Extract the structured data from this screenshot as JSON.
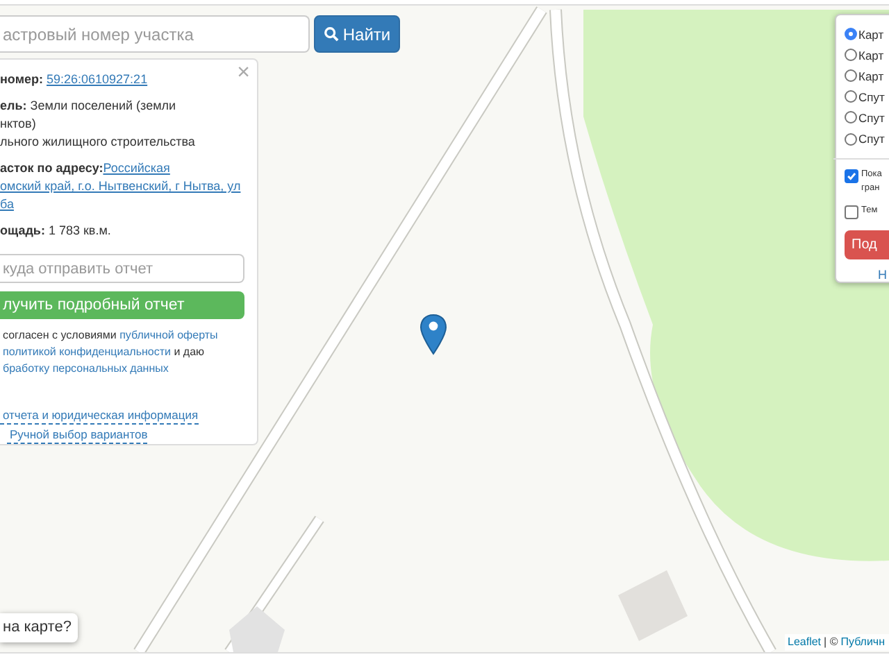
{
  "search": {
    "placeholder": "астровый номер участка",
    "button": "Найти"
  },
  "info": {
    "close": "×",
    "number_label": "номер:",
    "number_link": "59:26:0610927:21",
    "purpose": "**ель:** Земли поселений (земли\nнктов)\nльного жилищного строительства",
    "address_label": "асток по адресу:",
    "address_links": [
      "Российская",
      "омский край, г.о. Нытвенский, г Нытва, ул",
      "ба"
    ],
    "area": "**ощадь:** 1 783 кв.м.",
    "email_placeholder": "куда отправить отчет",
    "report_button": "лучить подробный отчет",
    "consent": [
      {
        "kind": "text",
        "text": "согласен с условиями"
      },
      {
        "kind": "link",
        "text": "публичной оферты"
      },
      {
        "kind": "break"
      },
      {
        "kind": "link",
        "text": "политикой конфиденциальности"
      },
      {
        "kind": "text",
        "text": "и даю"
      },
      {
        "kind": "break"
      },
      {
        "kind": "link",
        "text": "бработку персональных данных"
      }
    ],
    "links": [
      "отчета и юридическая информация",
      "Ручной выбор вариантов"
    ]
  },
  "layers": {
    "options": [
      {
        "label": "Карт",
        "selected": true
      },
      {
        "label": "Карт",
        "selected": false
      },
      {
        "label": "Карт",
        "selected": false
      },
      {
        "label": "Спут",
        "selected": false
      },
      {
        "label": "Спут",
        "selected": false
      },
      {
        "label": "Спут",
        "selected": false
      }
    ],
    "checks": [
      {
        "label": "Пока\nгран",
        "checked": true
      },
      {
        "label": "Тем",
        "checked": false
      }
    ],
    "button": "Под",
    "link": "Н"
  },
  "hint": "на карте?",
  "attribution": {
    "link1": "Leaflet",
    "separator": "| ©",
    "link2": "Публичн"
  }
}
